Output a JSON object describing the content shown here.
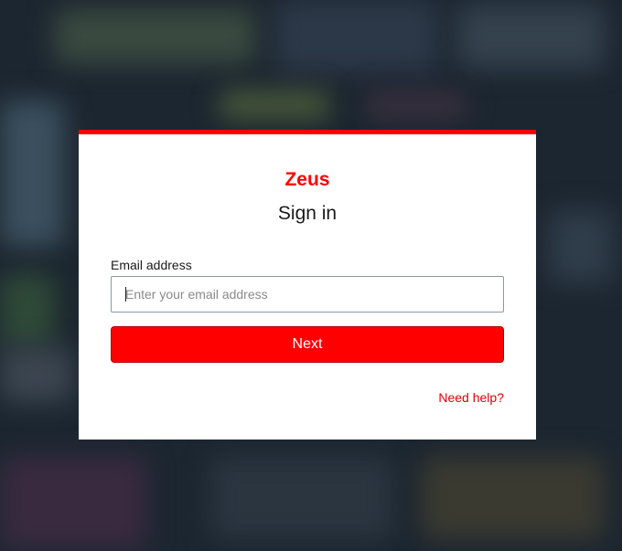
{
  "modal": {
    "brand": "Zeus",
    "title": "Sign in",
    "email_label": "Email address",
    "email_placeholder": "Enter your email address",
    "email_value": "",
    "next_label": "Next",
    "help_link": "Need help?"
  },
  "colors": {
    "accent": "#ff0000",
    "backdrop": "#1c2630",
    "modal_bg": "#ffffff"
  }
}
